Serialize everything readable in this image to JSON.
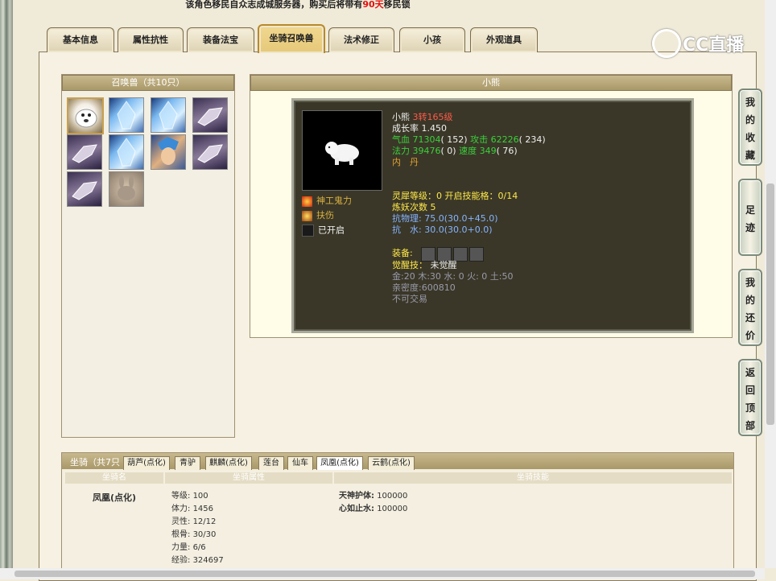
{
  "notice": {
    "prefix": "该角色移民自众志成城服务器，购买后将带有",
    "highlight": "90天",
    "suffix": "移民锁"
  },
  "tabs": [
    {
      "label": "基本信息"
    },
    {
      "label": "属性抗性"
    },
    {
      "label": "装备法宝"
    },
    {
      "label": "坐骑召唤兽",
      "active": true
    },
    {
      "label": "法术修正"
    },
    {
      "label": "小孩"
    },
    {
      "label": "外观道具"
    }
  ],
  "logo": {
    "text": "CC直播"
  },
  "summon_panel": {
    "title": "召唤兽（共10只）",
    "pets": [
      {
        "icon": "polar-bear-pet-icon"
      },
      {
        "icon": "ice-spirit-pet-icon"
      },
      {
        "icon": "ice-spirit-pet-icon"
      },
      {
        "icon": "wolf-pet-icon"
      },
      {
        "icon": "wolf-pet-icon"
      },
      {
        "icon": "ice-spirit-pet-icon"
      },
      {
        "icon": "blue-hair-warrior-pet-icon"
      },
      {
        "icon": "wolf-pet-icon"
      },
      {
        "icon": "wolf-pet-icon"
      },
      {
        "icon": "rabbit-pet-icon"
      }
    ]
  },
  "detail": {
    "title": "小熊",
    "name": "小熊",
    "level": "3转165级",
    "growth_label": "成长率",
    "growth": "1.450",
    "hp_label": "气血",
    "hp": "71304",
    "hp_extra": "( 152)",
    "atk_label": "攻击",
    "atk": "62226",
    "atk_extra": "( 234)",
    "mp_label": "法力",
    "mp": "39476",
    "mp_extra": "( 0)",
    "speed_label": "速度",
    "speed": "349",
    "speed_extra": "( 76)",
    "neidan": "内　丹",
    "skills": [
      {
        "label": "神工鬼力",
        "icon": "fire-skill-icon"
      },
      {
        "label": "扶伤",
        "icon": "flame-skill-icon"
      },
      {
        "label": "已开启",
        "icon": "empty-skill-icon"
      }
    ],
    "lingxi_label": "灵犀等级：",
    "lingxi_val": "0",
    "skillslot_label": "开启技能格：",
    "skillslot_val": "0/14",
    "refine_label": "炼妖次数",
    "refine_val": "5",
    "resist_phys_label": "抗物理:",
    "resist_phys": "75.0(30.0+45.0)",
    "resist_water_label": "抗　水:",
    "resist_water": "30.0(30.0+0.0)",
    "equip_label": "装备:",
    "awaken_label": "觉醒技：",
    "awaken_val": "未觉醒",
    "elements": "金:20 木:30 水: 0 火: 0 土:50",
    "intimacy": "亲密度:600810",
    "trade": "不可交易"
  },
  "side_buttons": [
    {
      "label": "我的收藏",
      "chars": [
        "我",
        "的",
        "收",
        "藏"
      ]
    },
    {
      "label": "足迹",
      "chars": [
        "足",
        "迹"
      ]
    },
    {
      "label": "我的还价",
      "chars": [
        "我",
        "的",
        "还",
        "价"
      ]
    },
    {
      "label": "返回顶部",
      "chars": [
        "返",
        "回",
        "顶",
        "部"
      ]
    }
  ],
  "mount_panel": {
    "title": "坐骑（共7只",
    "tabs": [
      {
        "label": "葫芦(点化)"
      },
      {
        "label": "青驴"
      },
      {
        "label": "麒麟(点化)"
      },
      {
        "label": "莲台"
      },
      {
        "label": "仙车"
      },
      {
        "label": "凤凰(点化)",
        "active": true
      },
      {
        "label": "云鹤(点化)"
      }
    ],
    "col_name": "坐骑名",
    "col_attr": "坐骑属性",
    "col_skill": "坐骑技能",
    "mount_name": "凤凰(点化)",
    "attrs": [
      {
        "label": "等级:",
        "value": "100"
      },
      {
        "label": "体力:",
        "value": "1456"
      },
      {
        "label": "灵性:",
        "value": "12/12"
      },
      {
        "label": "根骨:",
        "value": "30/30"
      },
      {
        "label": "力量:",
        "value": "6/6"
      },
      {
        "label": "经验:",
        "value": "324697"
      }
    ],
    "skills": [
      {
        "label": "天神护体:",
        "value": "100000"
      },
      {
        "label": "心如止水:",
        "value": "100000"
      }
    ]
  }
}
